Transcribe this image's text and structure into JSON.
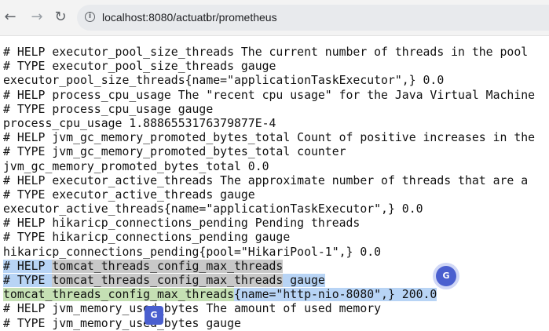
{
  "browser": {
    "url": "localhost:8080/actuator/prometheus"
  },
  "lines": [
    "# HELP executor_pool_size_threads The current number of threads in the pool",
    "# TYPE executor_pool_size_threads gauge",
    "executor_pool_size_threads{name=\"applicationTaskExecutor\",} 0.0",
    "# HELP process_cpu_usage The \"recent cpu usage\" for the Java Virtual Machine",
    "# TYPE process_cpu_usage gauge",
    "process_cpu_usage 1.8886553176379877E-4",
    "# HELP jvm_gc_memory_promoted_bytes_total Count of positive increases in the",
    "# TYPE jvm_gc_memory_promoted_bytes_total counter",
    "jvm_gc_memory_promoted_bytes_total 0.0",
    "# HELP executor_active_threads The approximate number of threads that are a",
    "# TYPE executor_active_threads gauge",
    "executor_active_threads{name=\"applicationTaskExecutor\",} 0.0",
    "# HELP hikaricp_connections_pending Pending threads",
    "# TYPE hikaricp_connections_pending gauge",
    "hikaricp_connections_pending{pool=\"HikariPool-1\",} 0.0"
  ],
  "selected": {
    "l1_prefix": "# HELP ",
    "l1_name": "tomcat_threads_config_max_threads",
    "l2_prefix": "# TYPE ",
    "l2_name": "tomcat_threads_config_max_threads",
    "l2_suffix": " gauge",
    "l3_name": "tomcat_threads_config_max_threads",
    "l3_suffix": "{name=\"http-nio-8080\",} 200.0"
  },
  "after": [
    "# HELP jvm_memory_used_bytes The amount of used memory",
    "# TYPE jvm_memory_used_bytes gauge"
  ],
  "icons": [
    "info-icon",
    "back-arrow-icon",
    "forward-arrow-icon",
    "reload-icon",
    "google-translate-icon"
  ]
}
